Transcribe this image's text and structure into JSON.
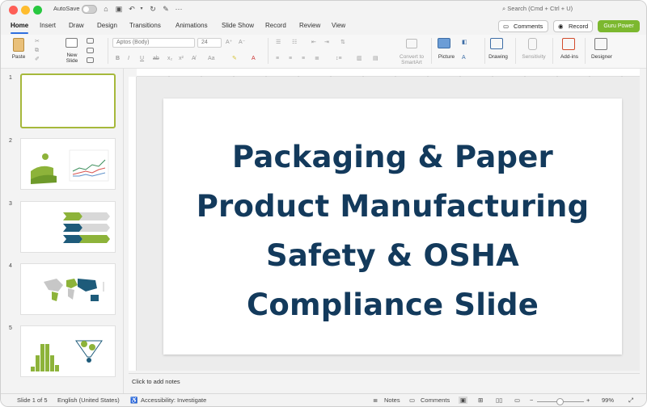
{
  "titlebar": {
    "autosave_label": "AutoSave",
    "search_placeholder": "Search (Cmd + Ctrl + U)",
    "more_label": "···"
  },
  "tabs": [
    "Home",
    "Insert",
    "Draw",
    "Design",
    "Transitions",
    "Animations",
    "Slide Show",
    "Record",
    "Review",
    "View"
  ],
  "actions": {
    "comments": "Comments",
    "record": "Record",
    "guru": "Guru Power"
  },
  "ribbon": {
    "paste": "Paste",
    "new_slide": "New\nSlide",
    "font_name": "Aptos (Body)",
    "font_size": "24",
    "convert_smartart": "Convert to\nSmartArt",
    "picture": "Picture",
    "drawing": "Drawing",
    "sensitivity": "Sensitivity",
    "addins": "Add-ins",
    "designer": "Designer"
  },
  "slides": [
    {
      "number": "1",
      "selected": true
    },
    {
      "number": "2"
    },
    {
      "number": "3"
    },
    {
      "number": "4"
    },
    {
      "number": "5"
    }
  ],
  "slide": {
    "title_lines": [
      "Packaging & Paper",
      "Product Manufacturing",
      "Safety & OSHA",
      "Compliance Slide"
    ]
  },
  "notes_placeholder": "Click to add notes",
  "status": {
    "slide_position": "Slide 1 of 5",
    "language": "English (United States)",
    "accessibility": "Accessibility: Investigate",
    "notes": "Notes",
    "comments": "Comments",
    "zoom": "99%"
  },
  "colors": {
    "title_text": "#133a5c",
    "accent_green": "#7cb82f",
    "tab_underline": "#2f6fde",
    "selected_thumb_border": "#a6b83b"
  },
  "icons": [
    "undo-icon",
    "redo-icon",
    "save-icon",
    "home-icon",
    "search-icon",
    "paste-icon",
    "new-slide-icon",
    "picture-icon",
    "shapes-icon",
    "drawing-icon",
    "sensitivity-icon",
    "addins-icon",
    "designer-icon",
    "notes-icon",
    "comments-icon",
    "normal-view-icon",
    "slide-sorter-icon",
    "reading-view-icon",
    "slideshow-icon",
    "fit-icon"
  ]
}
